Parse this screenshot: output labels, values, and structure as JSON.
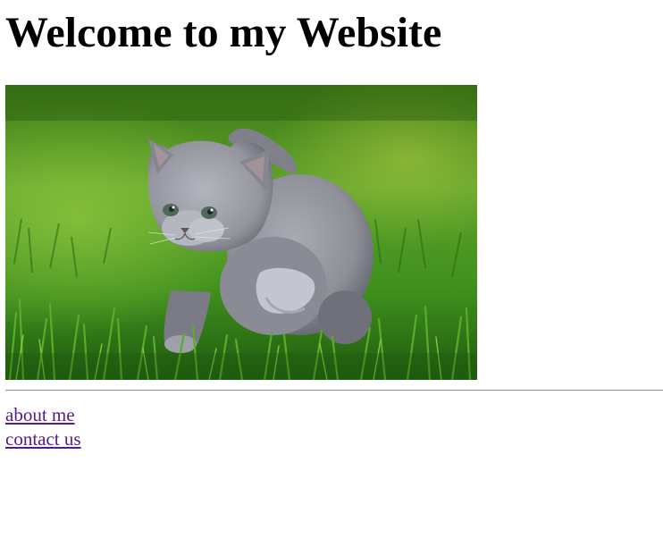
{
  "header": {
    "title": "Welcome to my Website"
  },
  "photo": {
    "subject": "kitten-in-grass",
    "colors": {
      "grass_dark": "#1f5a0f",
      "grass_mid": "#3f8f1d",
      "grass_light": "#7ec23a",
      "fur": "#8e8f98",
      "fur_light": "#c4c6cf",
      "fur_dark": "#5d5f68"
    }
  },
  "nav": {
    "links": [
      {
        "label": "about me"
      },
      {
        "label": "contact us"
      }
    ],
    "visited_link_color": "#551a8b"
  }
}
